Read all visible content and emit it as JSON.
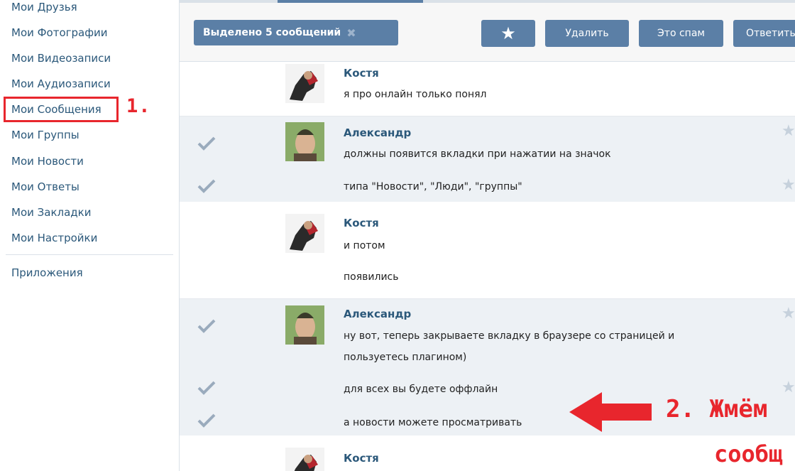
{
  "sidebar": {
    "items": [
      {
        "label": "Мои Друзья"
      },
      {
        "label": "Мои Фотографии"
      },
      {
        "label": "Мои Видеозаписи"
      },
      {
        "label": "Мои Аудиозаписи"
      },
      {
        "label": "Мои Сообщения"
      },
      {
        "label": "Мои Группы"
      },
      {
        "label": "Мои Новости"
      },
      {
        "label": "Мои Ответы"
      },
      {
        "label": "Мои Закладки"
      },
      {
        "label": "Мои Настройки"
      }
    ],
    "apps_label": "Приложения"
  },
  "toolbar": {
    "selected_label": "Выделено 5 сообщений",
    "delete_label": "Удалить",
    "spam_label": "Это спам",
    "reply_label": "Ответить"
  },
  "messages": [
    {
      "author": "Костя",
      "lines": [
        "я про онлайн только понял"
      ]
    },
    {
      "author": "Александр",
      "lines": [
        "должны появится вкладки при нажатии на значок",
        "типа \"Новости\", \"Люди\", \"группы\""
      ]
    },
    {
      "author": "Костя",
      "lines": [
        "и потом",
        "появились"
      ]
    },
    {
      "author": "Александр",
      "lines": [
        "ну вот, теперь закрываете вкладку в браузере со страницей и",
        "пользуетесь плагином)",
        "для всех вы будете оффлайн",
        "а новости можете просматривать"
      ]
    },
    {
      "author": "Костя",
      "lines": []
    }
  ],
  "annotations": {
    "step1": "1.",
    "step2": "2. Жмём",
    "step2_cont": "сообщ"
  },
  "colors": {
    "accent": "#5b7fa6",
    "link": "#2b587a",
    "annotation": "#e8262d",
    "selected_row": "#edf1f5"
  }
}
